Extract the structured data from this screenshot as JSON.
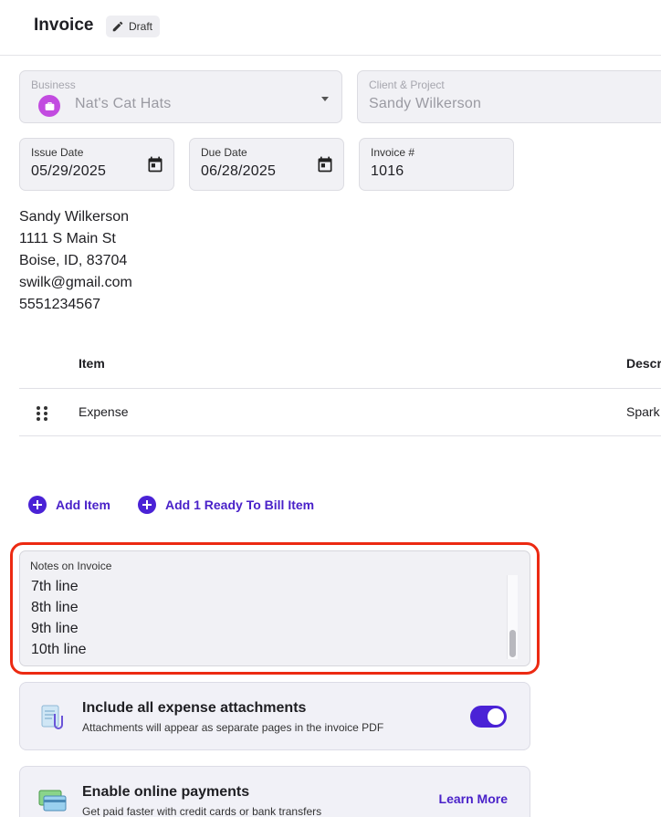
{
  "header": {
    "title": "Invoice",
    "status": "Draft"
  },
  "business": {
    "label": "Business",
    "value": "Nat's Cat Hats"
  },
  "client": {
    "label": "Client & Project",
    "value": "Sandy Wilkerson"
  },
  "issue_date": {
    "label": "Issue Date",
    "value": "05/29/2025"
  },
  "due_date": {
    "label": "Due Date",
    "value": "06/28/2025"
  },
  "invoice_number": {
    "label": "Invoice #",
    "value": "1016"
  },
  "address": [
    "Sandy Wilkerson",
    "1111 S Main St",
    "Boise, ID, 83704",
    "swilk@gmail.com",
    "5551234567"
  ],
  "table": {
    "headers": {
      "item": "Item",
      "description": "Descr"
    },
    "rows": [
      {
        "item": "Expense",
        "description": "Spark"
      }
    ]
  },
  "actions": {
    "add_item": "Add Item",
    "add_ready": "Add 1 Ready To Bill Item"
  },
  "notes": {
    "label": "Notes on Invoice",
    "lines": [
      "7th line",
      "8th line",
      "9th line",
      "10th line"
    ]
  },
  "attachments": {
    "title": "Include all expense attachments",
    "subtitle": "Attachments will appear as separate pages in the invoice PDF",
    "enabled": true
  },
  "payments": {
    "title": "Enable online payments",
    "subtitle": "Get paid faster with credit cards or bank transfers",
    "link": "Learn More"
  },
  "colors": {
    "accent": "#4a22d6",
    "highlight": "#ec2a12",
    "business_icon": "#c24be0"
  },
  "icons": {
    "status": "pencil-icon",
    "business": "briefcase-icon",
    "date": "calendar-icon",
    "drag": "drag-handle-icon",
    "add": "plus-circle-icon",
    "attachments": "paperclip-document-icon",
    "payments": "credit-card-icon"
  }
}
